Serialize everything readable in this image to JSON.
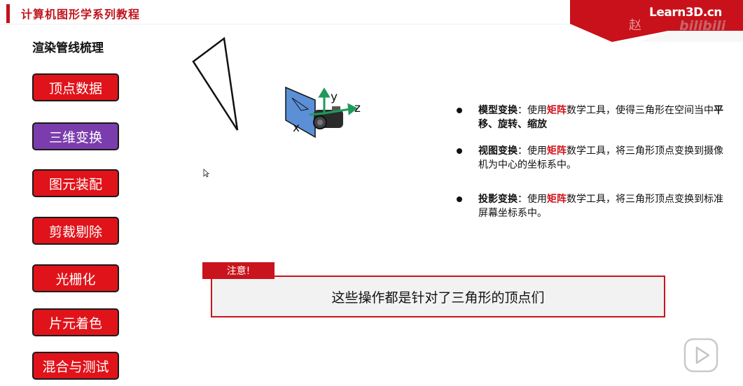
{
  "header": {
    "title": "计算机图形学系列教程",
    "brand": "Learn3D.cn",
    "watermark_a": "赵",
    "watermark_b": "bilibili"
  },
  "sidebar": {
    "heading": "渲染管线梳理",
    "stages": [
      {
        "label": "顶点数据",
        "active": false
      },
      {
        "label": "三维变换",
        "active": true
      },
      {
        "label": "图元装配",
        "active": false
      },
      {
        "label": "剪裁剔除",
        "active": false
      },
      {
        "label": "光栅化",
        "active": false
      },
      {
        "label": "片元着色",
        "active": false
      },
      {
        "label": "混合与测试",
        "active": false
      }
    ]
  },
  "scene": {
    "axis_y": "y",
    "axis_z": "z",
    "axis_x": "x"
  },
  "bullets": [
    {
      "term": "模型变换",
      "colon": "：",
      "pre": "使用",
      "hl": "矩阵",
      "post": "数学工具，使得三角形在空间当中",
      "bold_tail": "平移、旋转、缩放"
    },
    {
      "term": "视图变换",
      "colon": "：",
      "pre": "使用",
      "hl": "矩阵",
      "post": "数学工具，将三角形顶点变换到摄像机为中心的坐标系中。",
      "bold_tail": ""
    },
    {
      "term": "投影变换",
      "colon": "：",
      "pre": "使用",
      "hl": "矩阵",
      "post": "数学工具，将三角形顶点变换到标准屏幕坐标系中。",
      "bold_tail": ""
    }
  ],
  "note": {
    "tag": "注意!",
    "text": "这些操作都是针对了三角形的顶点们"
  },
  "colors": {
    "accent_red": "#e0131a",
    "active_purple": "#7b3dad",
    "axis_green": "#1f9a5a"
  },
  "icons": {
    "play": "play-icon",
    "cursor": "cursor-icon"
  }
}
